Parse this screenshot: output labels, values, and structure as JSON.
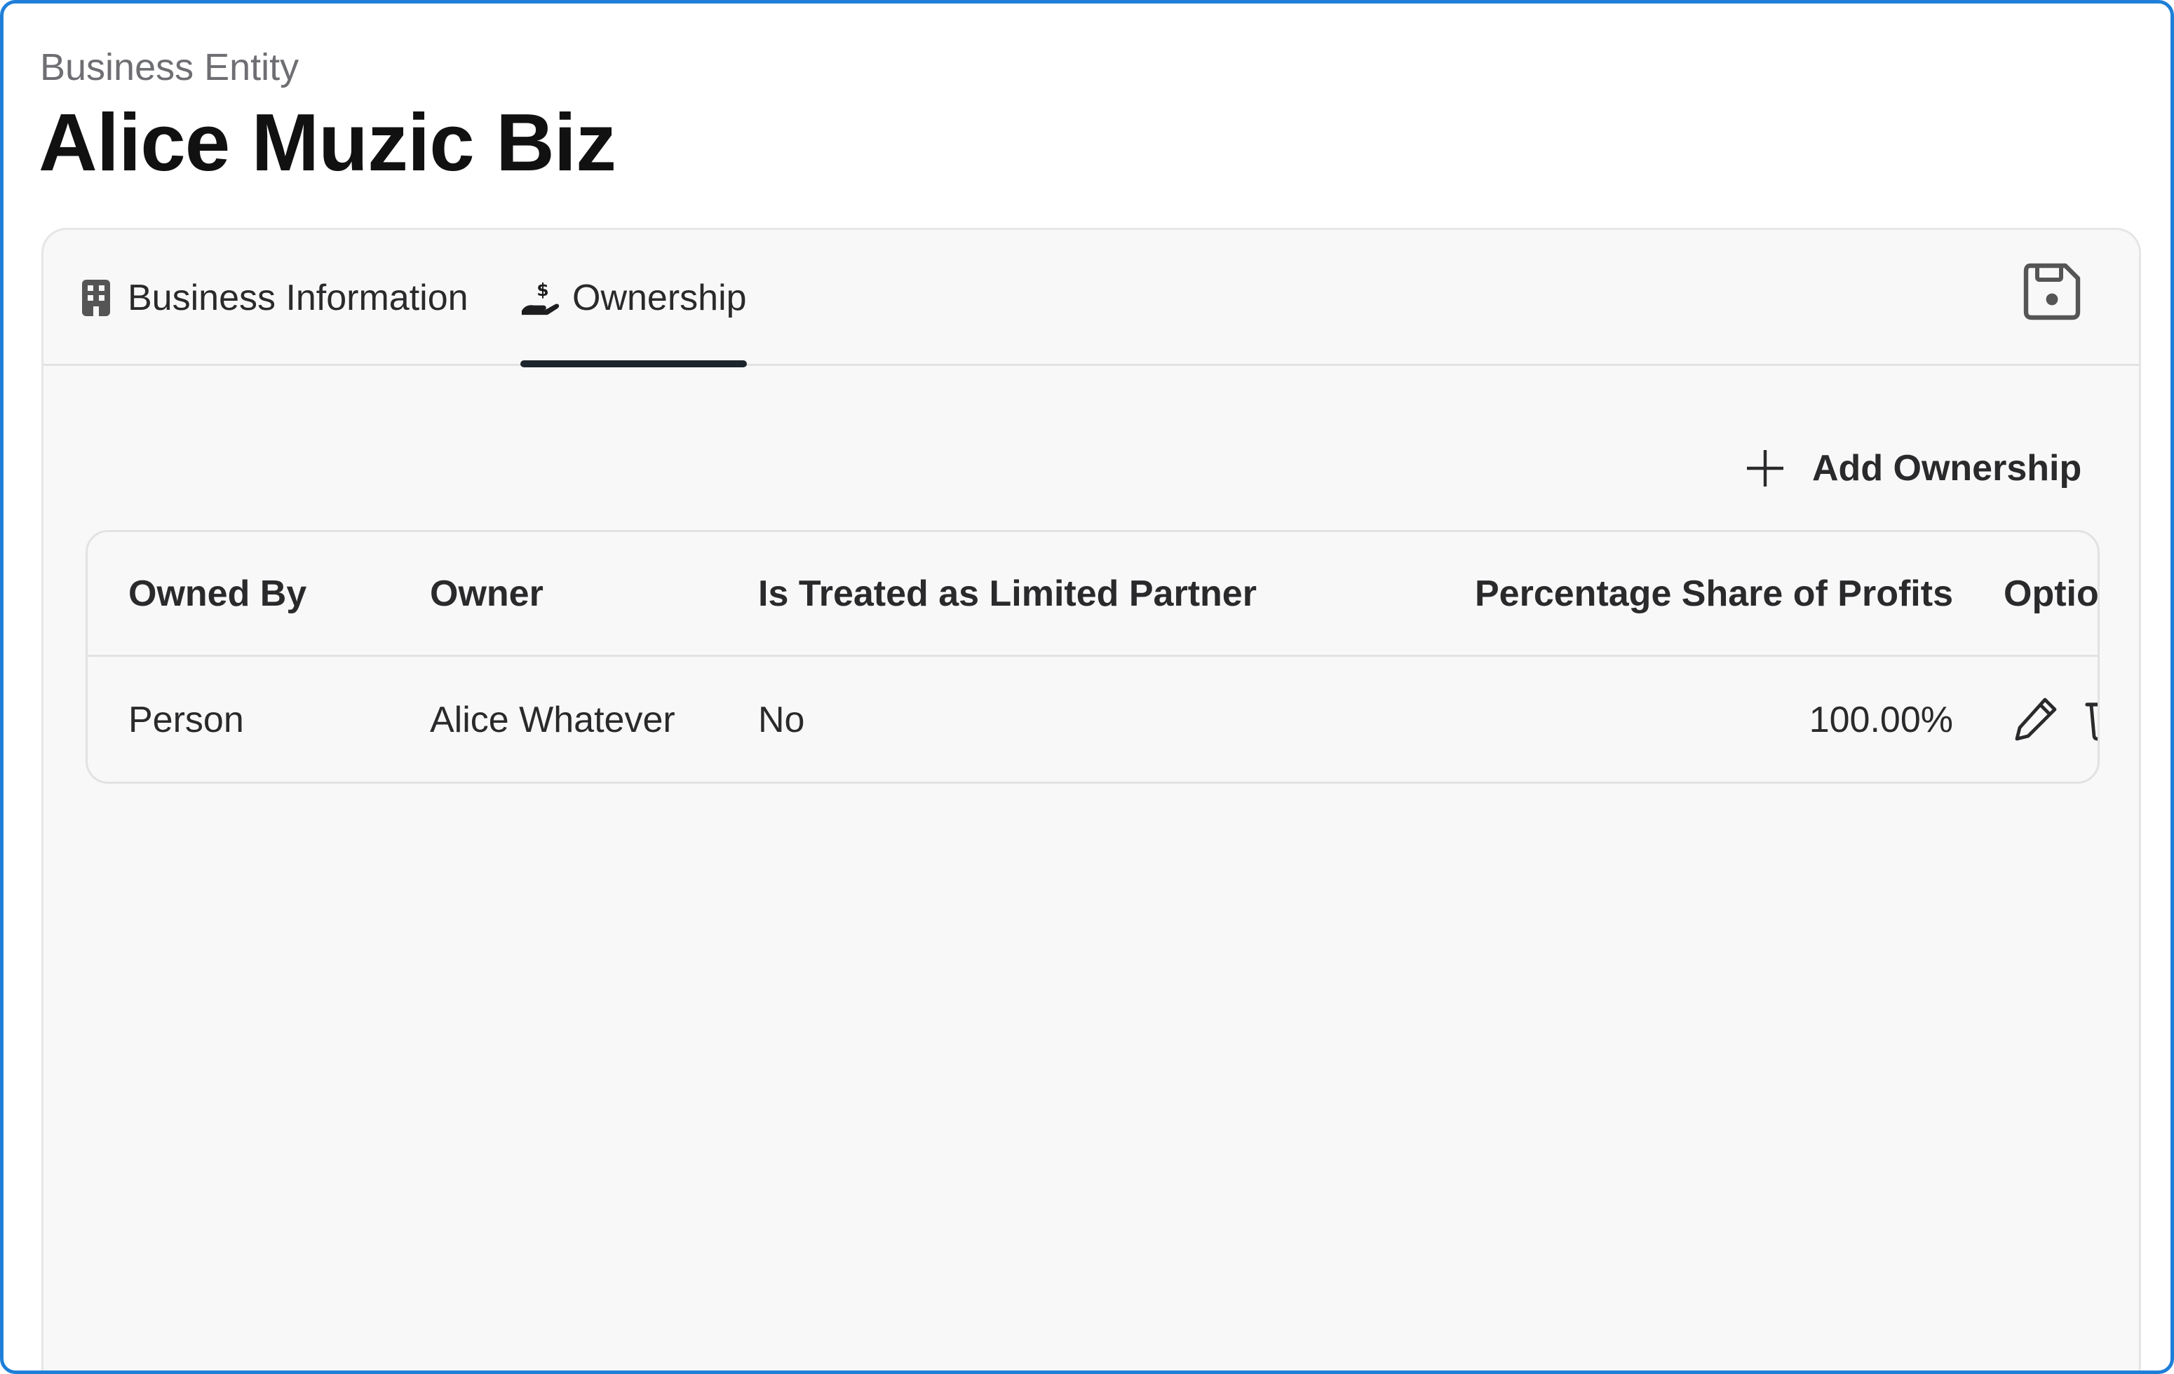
{
  "header": {
    "subtitle": "Business Entity",
    "title": "Alice Muzic Biz"
  },
  "tabs": [
    {
      "label": "Business Information",
      "icon": "building-icon",
      "active": false
    },
    {
      "label": "Ownership",
      "icon": "hand-dollar-icon",
      "active": true
    }
  ],
  "toolbar": {
    "save_icon": "floppy-disk-icon",
    "add_label": "Add Ownership"
  },
  "table": {
    "columns": [
      "Owned By",
      "Owner",
      "Is Treated as Limited Partner",
      "Percentage Share of Profits",
      "Options"
    ],
    "rows": [
      {
        "owned_by": "Person",
        "owner": "Alice Whatever",
        "limited_partner": "No",
        "share": "100.00%"
      }
    ]
  },
  "colors": {
    "window_border": "#1f7fd8",
    "active_tab_underline": "#1d252c",
    "card_background": "#f8f8f8"
  }
}
